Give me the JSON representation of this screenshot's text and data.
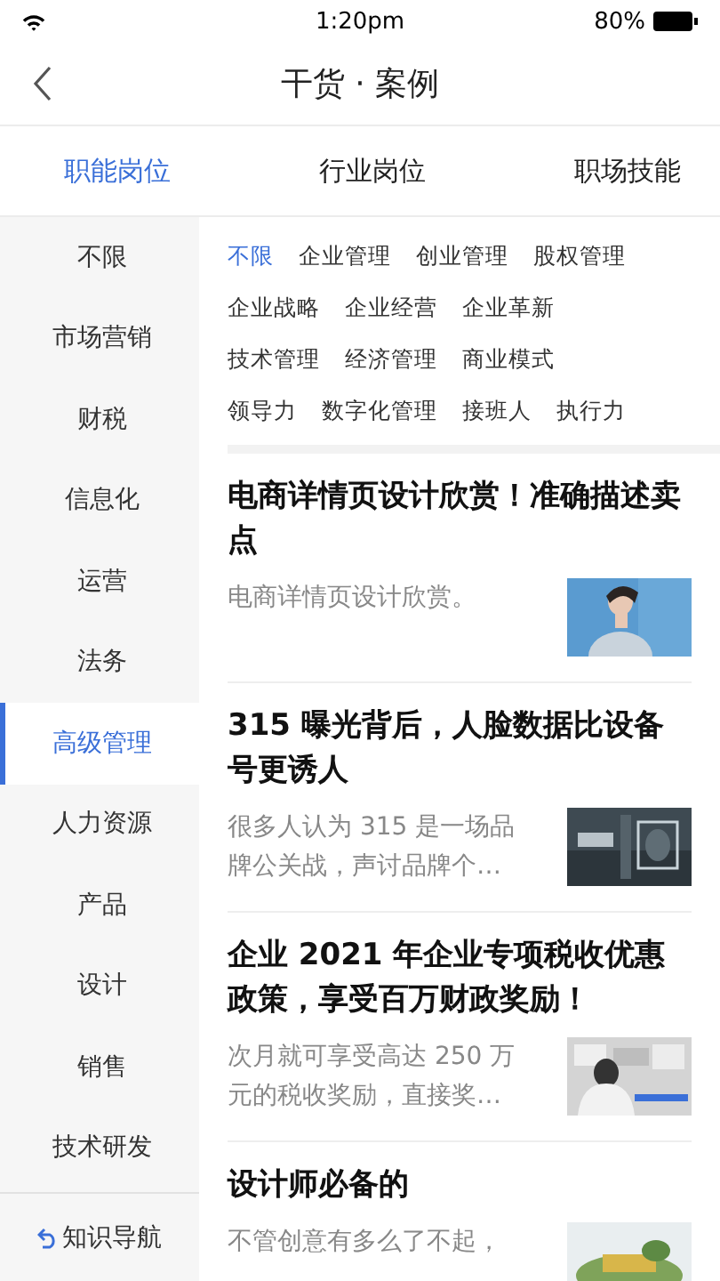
{
  "status_bar": {
    "time": "1:20pm",
    "battery": "80%"
  },
  "header": {
    "title": "干货 · 案例"
  },
  "tabs": [
    {
      "label": "职能岗位",
      "selected": true
    },
    {
      "label": "行业岗位",
      "selected": false
    },
    {
      "label": "职场技能",
      "selected": false
    }
  ],
  "sidebar": {
    "items": [
      {
        "label": "不限",
        "selected": false
      },
      {
        "label": "市场营销",
        "selected": false
      },
      {
        "label": "财税",
        "selected": false
      },
      {
        "label": "信息化",
        "selected": false
      },
      {
        "label": "运营",
        "selected": false
      },
      {
        "label": "法务",
        "selected": false
      },
      {
        "label": "高级管理",
        "selected": true
      },
      {
        "label": "人力资源",
        "selected": false
      },
      {
        "label": "产品",
        "selected": false
      },
      {
        "label": "设计",
        "selected": false
      },
      {
        "label": "销售",
        "selected": false
      },
      {
        "label": "技术研发",
        "selected": false
      }
    ],
    "footer_link": "知识导航"
  },
  "tag_rows": [
    [
      {
        "label": "不限",
        "selected": true
      },
      {
        "label": "企业管理",
        "selected": false
      },
      {
        "label": "创业管理",
        "selected": false
      },
      {
        "label": "股权管理",
        "selected": false
      }
    ],
    [
      {
        "label": "企业战略",
        "selected": false
      },
      {
        "label": "企业经营",
        "selected": false
      },
      {
        "label": "企业革新",
        "selected": false
      }
    ],
    [
      {
        "label": "技术管理",
        "selected": false
      },
      {
        "label": "经济管理",
        "selected": false
      },
      {
        "label": "商业模式",
        "selected": false
      }
    ],
    [
      {
        "label": "领导力",
        "selected": false
      },
      {
        "label": "数字化管理",
        "selected": false
      },
      {
        "label": "接班人",
        "selected": false
      },
      {
        "label": "执行力",
        "selected": false
      }
    ]
  ],
  "articles": [
    {
      "title": "电商详情页设计欣赏！准确描述卖点",
      "summary": "电商详情页设计欣赏。"
    },
    {
      "title": "315 曝光背后，人脸数据比设备号更诱人",
      "summary": "很多人认为 315 是一场品牌公关战，声讨品牌个…"
    },
    {
      "title": "企业 2021 年企业专项税收优惠政策，享受百万财政奖励！",
      "summary": "次月就可享受高达 250 万元的税收奖励，直接奖…"
    },
    {
      "title": "设计师必备的",
      "summary": "不管创意有多么了不起，"
    }
  ]
}
